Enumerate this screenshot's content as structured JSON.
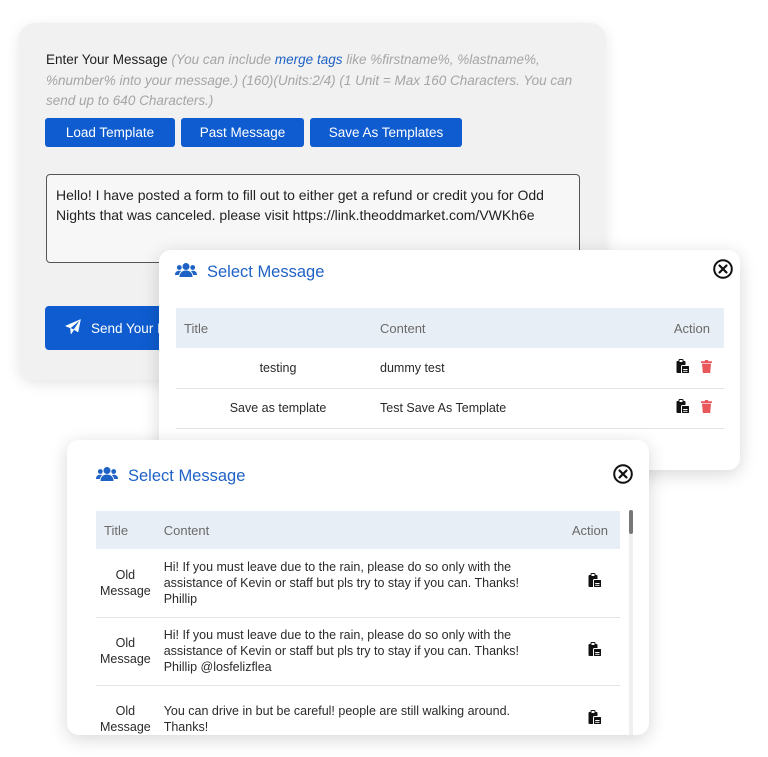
{
  "compose": {
    "label": "Enter Your Message",
    "hint_part1": " (You can include ",
    "merge_tags_link": "merge tags",
    "hint_part2": " like %firstname%, %lastname%, %number% into your message.) (160)(Units:2/4) (1 Unit = Max 160 Characters. You can send up to 640 Characters.)",
    "buttons": {
      "load": "Load Template",
      "past": "Past Message",
      "save": "Save As Templates"
    },
    "message": "Hello! I have posted a form to fill out to either get a refund or credit you for Odd Nights that was canceled. please visit https://link.theoddmarket.com/VWKh6e",
    "send_label": "Send Your M"
  },
  "modal_templates": {
    "title": "Select Message",
    "columns": {
      "title": "Title",
      "content": "Content",
      "action": "Action"
    },
    "rows": [
      {
        "title": "testing",
        "content": "dummy test"
      },
      {
        "title": "Save as template",
        "content": "Test Save As Template"
      }
    ]
  },
  "modal_past": {
    "title": "Select Message",
    "columns": {
      "title": "Title",
      "content": "Content",
      "action": "Action"
    },
    "rows": [
      {
        "title": "Old Message",
        "content": "Hi! If you must leave due to the rain, please do so only with the assistance of Kevin or staff but pls try to stay if you can. Thanks! Phillip"
      },
      {
        "title": "Old Message",
        "content": "Hi! If you must leave due to the rain, please do so only with the assistance of Kevin or staff but pls try to stay if you can. Thanks! Phillip @losfelizflea"
      },
      {
        "title": "Old Message",
        "content": "You can drive in but be careful! people are still walking around. Thanks!"
      }
    ]
  },
  "colors": {
    "primary": "#0e5ccf",
    "title_blue": "#1f62c6",
    "delete_red": "#e8585b",
    "table_header": "#e8eef5"
  },
  "icons": {
    "users": "users-icon",
    "close": "close-circle-icon",
    "paste": "paste-icon",
    "trash": "trash-icon",
    "send": "paper-plane-icon"
  }
}
